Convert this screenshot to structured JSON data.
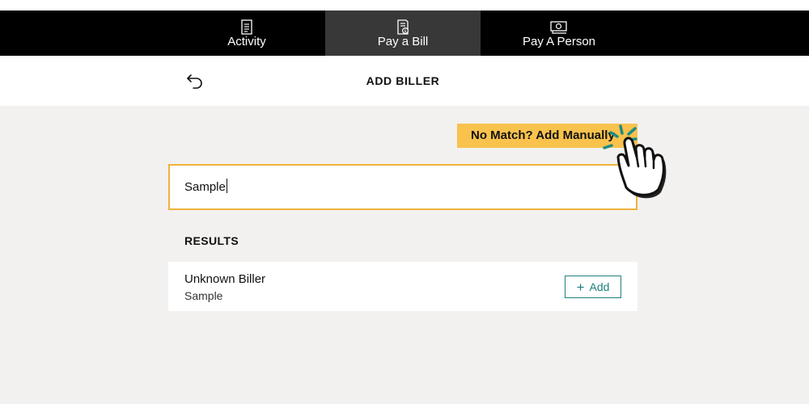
{
  "nav": {
    "tabs": [
      {
        "label": "Activity",
        "icon": "activity-list-icon"
      },
      {
        "label": "Pay a Bill",
        "icon": "bill-icon",
        "active": true
      },
      {
        "label": "Pay A Person",
        "icon": "money-icon"
      }
    ]
  },
  "header": {
    "title": "ADD BILLER",
    "back_icon": "back-arrow-icon"
  },
  "manual_add": {
    "label": "No Match?  Add Manually"
  },
  "search": {
    "value": "Sample"
  },
  "results": {
    "heading": "RESULTS",
    "items": [
      {
        "name": "Unknown Biller",
        "subtitle": "Sample",
        "action_label": "Add"
      }
    ]
  },
  "colors": {
    "nav_bg": "#000000",
    "active_tab_bg": "#383838",
    "accent_yellow": "#f8c24d",
    "input_border": "#f0b23d",
    "teal": "#1e7e7e",
    "page_bg": "#f2f1ef"
  }
}
